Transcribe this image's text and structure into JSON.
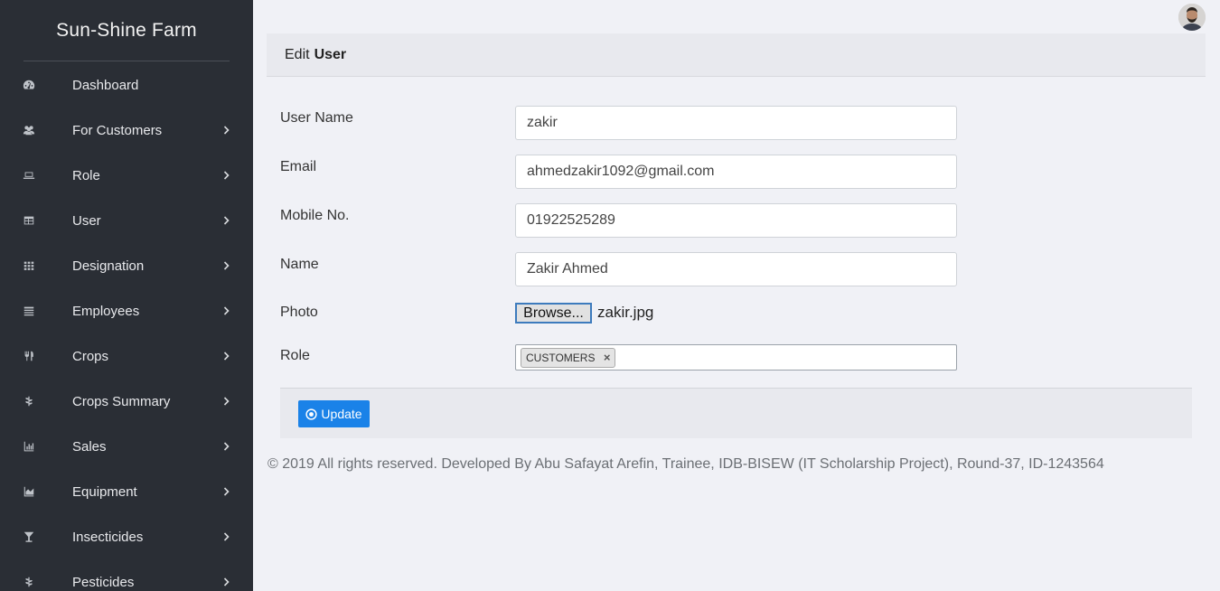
{
  "sidebar": {
    "brand": "Sun-Shine Farm",
    "items": [
      {
        "label": "Dashboard",
        "icon": "dashboard-icon",
        "chevron": false
      },
      {
        "label": "For Customers",
        "icon": "users-icon",
        "chevron": true
      },
      {
        "label": "Role",
        "icon": "laptop-icon",
        "chevron": true
      },
      {
        "label": "User",
        "icon": "table-icon",
        "chevron": true
      },
      {
        "label": "Designation",
        "icon": "grid-icon",
        "chevron": true
      },
      {
        "label": "Employees",
        "icon": "list-icon",
        "chevron": true
      },
      {
        "label": "Crops",
        "icon": "utensils-icon",
        "chevron": true
      },
      {
        "label": "Crops Summary",
        "icon": "plant-icon",
        "chevron": true
      },
      {
        "label": "Sales",
        "icon": "bar-chart-icon",
        "chevron": true
      },
      {
        "label": "Equipment",
        "icon": "area-chart-icon",
        "chevron": true
      },
      {
        "label": "Insecticides",
        "icon": "glass-icon",
        "chevron": true
      },
      {
        "label": "Pesticides",
        "icon": "plant-icon",
        "chevron": true
      }
    ]
  },
  "header": {
    "avatar_icon": "user-avatar"
  },
  "card": {
    "title_prefix": "Edit",
    "title_bold": "User"
  },
  "form": {
    "username": {
      "label": "User Name",
      "value": "zakir"
    },
    "email": {
      "label": "Email",
      "value": "ahmedzakir1092@gmail.com"
    },
    "mobile": {
      "label": "Mobile No.",
      "value": "01922525289"
    },
    "name": {
      "label": "Name",
      "value": "Zakir Ahmed"
    },
    "photo": {
      "label": "Photo",
      "button_label": "Browse...",
      "file_name": "zakir.jpg"
    },
    "role": {
      "label": "Role",
      "selected": "CUSTOMERS",
      "remove_symbol": "×"
    }
  },
  "actions": {
    "update_label": "Update"
  },
  "footer": {
    "text": "© 2019 All rights reserved. Developed By Abu Safayat Arefin, Trainee, IDB-BISEW (IT Scholarship Project), Round-37, ID-1243564"
  },
  "colors": {
    "sidebar_bg": "#2a2e35",
    "page_bg": "#f0f1f6",
    "primary": "#1a82e8"
  }
}
